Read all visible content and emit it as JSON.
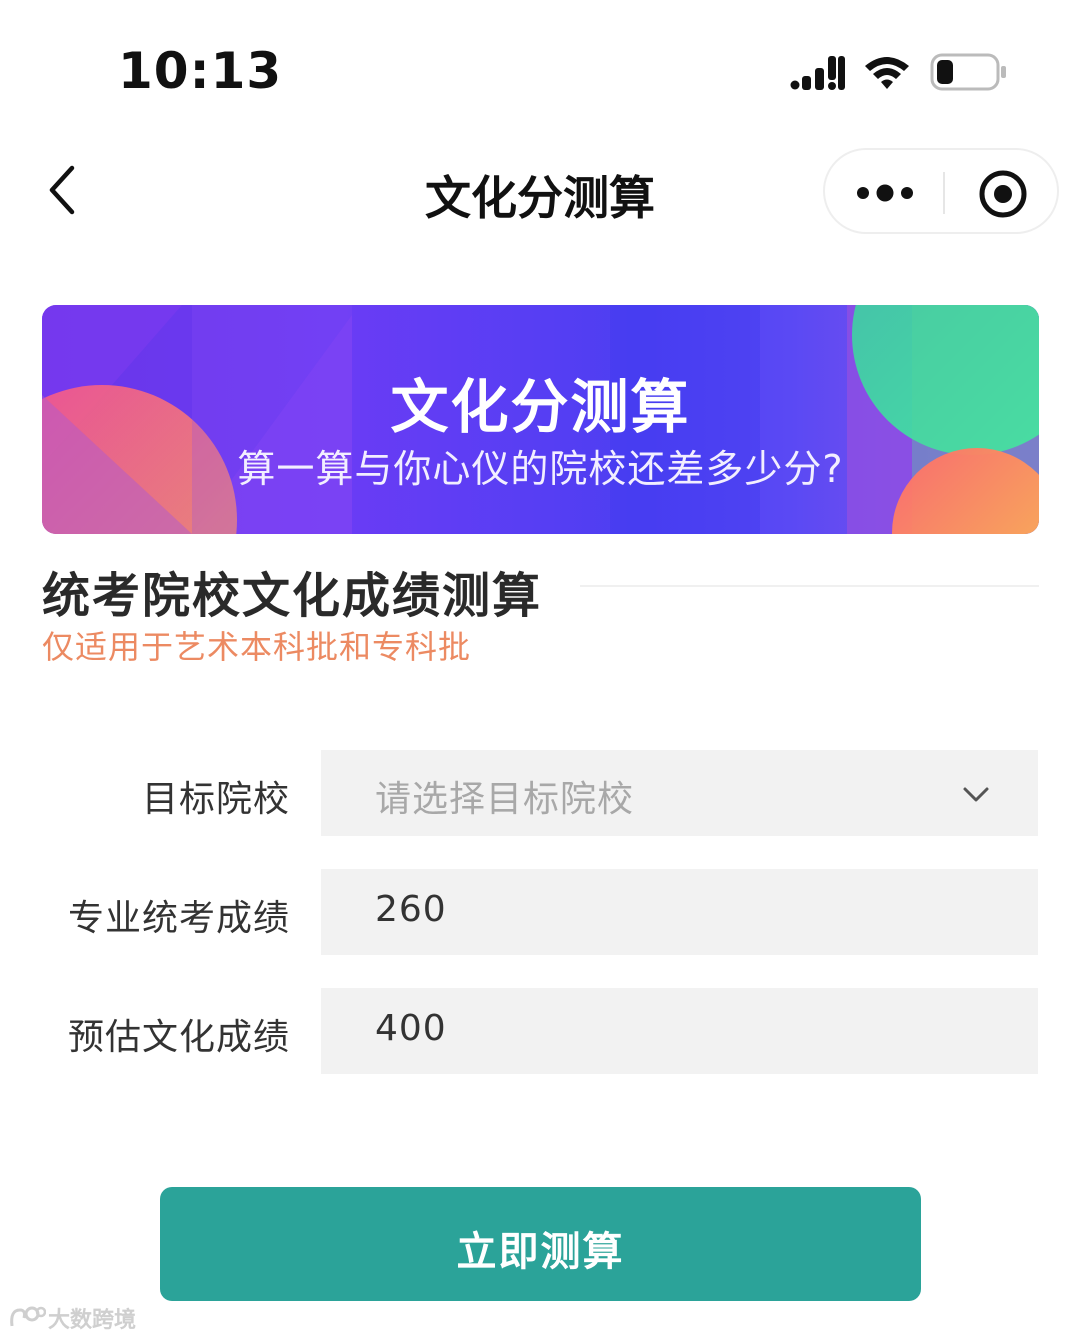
{
  "status_bar": {
    "time": "10:13"
  },
  "nav": {
    "title": "文化分测算"
  },
  "banner": {
    "title": "文化分测算",
    "subtitle": "算一算与你心仪的院校还差多少分?"
  },
  "section": {
    "title": "统考院校文化成绩测算",
    "subtitle": "仅适用于艺术本科批和专科批"
  },
  "form": {
    "school": {
      "label": "目标院校",
      "placeholder": "请选择目标院校"
    },
    "professional_score": {
      "label": "专业统考成绩",
      "value": "260"
    },
    "culture_score": {
      "label": "预估文化成绩",
      "value": "400"
    }
  },
  "submit_label": "立即测算",
  "watermark": "大数跨境",
  "colors": {
    "accent": "#2ba399",
    "subtitle": "#ec8a62",
    "field_bg": "#f2f2f2"
  }
}
